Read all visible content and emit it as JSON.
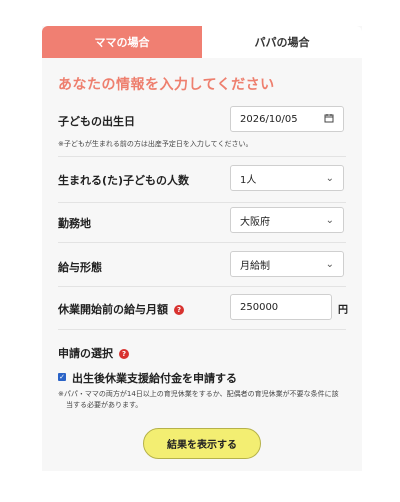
{
  "tabs": [
    {
      "label": "ママの場合",
      "active": true
    },
    {
      "label": "パパの場合",
      "active": false
    }
  ],
  "heading": "あなたの情報を入力してください",
  "form": {
    "birthdate": {
      "label": "子どもの出生日",
      "value": "2026/10/05",
      "note": "※子どもが生まれる前の方は出産予定日を入力してください。"
    },
    "children_count": {
      "label": "生まれる(た)子どもの人数",
      "value": "1人"
    },
    "workplace": {
      "label": "勤務地",
      "value": "大阪府"
    },
    "pay_type": {
      "label": "給与形態",
      "value": "月給制"
    },
    "monthly_salary": {
      "label": "休業開始前の給与月額",
      "value": "250000",
      "unit": "円"
    },
    "application": {
      "label": "申請の選択",
      "checkbox_label": "出生後休業支援給付金を申請する",
      "checked": true,
      "note_line1": "※パパ・ママの両方が14日以上の育児休業をするか、配偶者の育児休業が不要な条件に該",
      "note_line2": "当する必要があります。"
    }
  },
  "result_button": "結果を表示する",
  "colors": {
    "accent": "#f07f72",
    "heading": "#ee7f6e",
    "button": "#f3ee72",
    "checkbox": "#2a63c7",
    "help": "#d8322f"
  },
  "icons": {
    "date": "calendar-icon",
    "select": "chevron-down-icon",
    "help": "question-icon"
  }
}
